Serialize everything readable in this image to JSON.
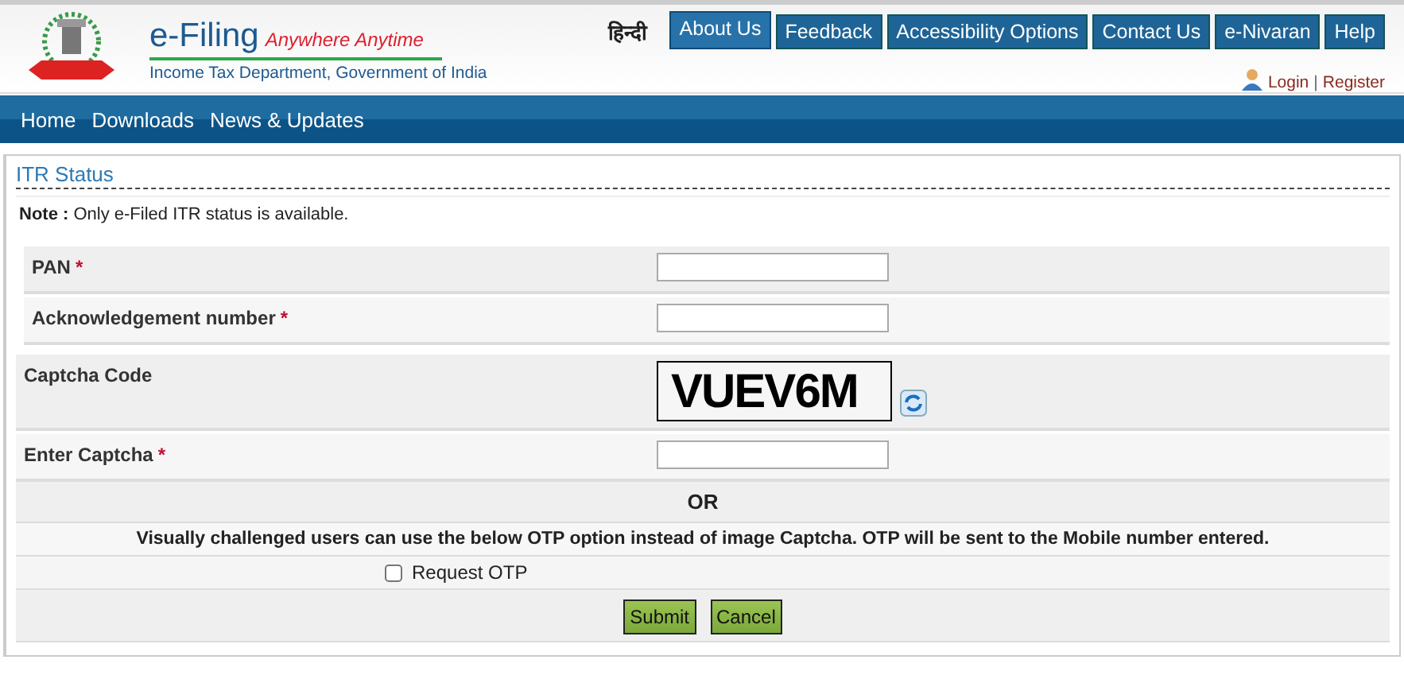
{
  "header": {
    "title": "e-Filing",
    "tagline": "Anywhere Anytime",
    "subtitle": "Income Tax Department, Government of India",
    "language_link": "हिन्दी",
    "top_links": [
      {
        "label": "About Us",
        "selected": true
      },
      {
        "label": "Feedback",
        "selected": false
      },
      {
        "label": "Accessibility Options",
        "selected": false
      },
      {
        "label": "Contact Us",
        "selected": false
      },
      {
        "label": "e-Nivaran",
        "selected": false
      },
      {
        "label": "Help",
        "selected": false
      }
    ],
    "login": "Login",
    "separator": "|",
    "register": "Register"
  },
  "nav": [
    "Home",
    "Downloads",
    "News & Updates"
  ],
  "panel": {
    "title": "ITR Status",
    "note_label": "Note :",
    "note": "Only e-Filed ITR status is available.",
    "fields": [
      {
        "kind": "input",
        "label": "PAN",
        "required_mark": "*",
        "indent": true
      },
      {
        "kind": "input",
        "label": "Acknowledgement number",
        "required_mark": "*",
        "indent": true
      },
      {
        "kind": "captcha",
        "label": "Captcha Code",
        "captcha": "VUEV6M",
        "indent": false
      },
      {
        "kind": "input",
        "label": "Enter Captcha",
        "required_mark": "*",
        "indent": false
      }
    ],
    "or": "OR",
    "otp_info": "Visually challenged users can use the below OTP option instead of image Captcha. OTP will be sent to the Mobile number entered.",
    "otp_option": {
      "label": "Request OTP",
      "checked": false
    },
    "buttons": [
      "Submit",
      "Cancel"
    ]
  }
}
